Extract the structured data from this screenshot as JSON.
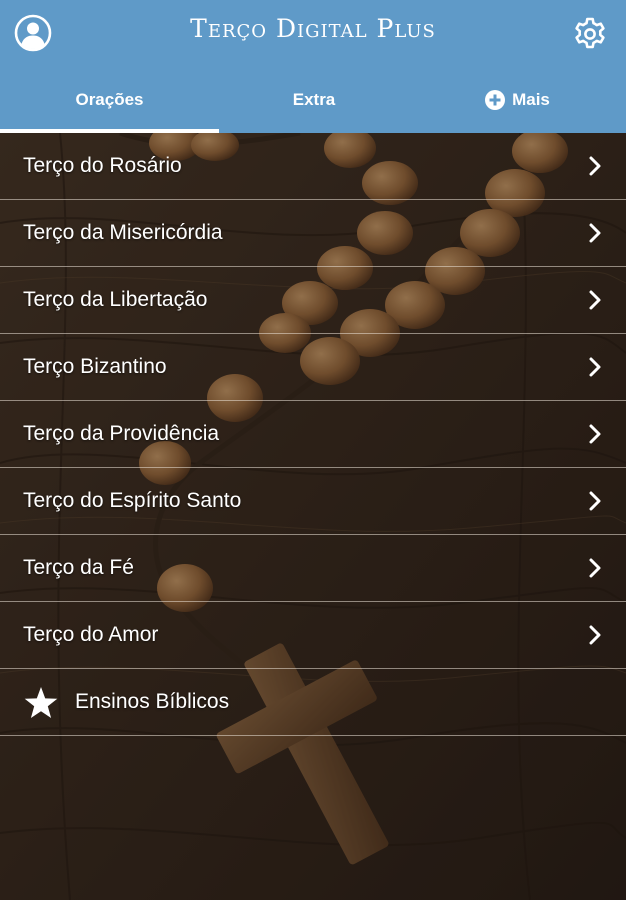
{
  "app": {
    "title": "Terço Digital Plus"
  },
  "header": {
    "profile_icon": "user-circle-icon",
    "settings_icon": "gear-icon"
  },
  "tabs": [
    {
      "label": "Orações",
      "active": true
    },
    {
      "label": "Extra",
      "active": false
    },
    {
      "label": "Mais",
      "active": false,
      "icon": "plus-circle-icon"
    }
  ],
  "menu": {
    "items": [
      {
        "label": "Terço do Rosário",
        "icon": "chevron-right-icon"
      },
      {
        "label": "Terço da Misericórdia",
        "icon": "chevron-right-icon"
      },
      {
        "label": "Terço da Libertação",
        "icon": "chevron-right-icon"
      },
      {
        "label": "Terço Bizantino",
        "icon": "chevron-right-icon"
      },
      {
        "label": "Terço da Providência",
        "icon": "chevron-right-icon"
      },
      {
        "label": "Terço do Espírito Santo",
        "icon": "chevron-right-icon"
      },
      {
        "label": "Terço da Fé",
        "icon": "chevron-right-icon"
      },
      {
        "label": "Terço do Amor",
        "icon": "chevron-right-icon"
      }
    ],
    "special": {
      "label": "Ensinos Bíblicos",
      "icon": "star-icon"
    }
  },
  "colors": {
    "header": "#5f9ac8",
    "text": "#ffffff",
    "background_wood": "#3a2a1f"
  }
}
